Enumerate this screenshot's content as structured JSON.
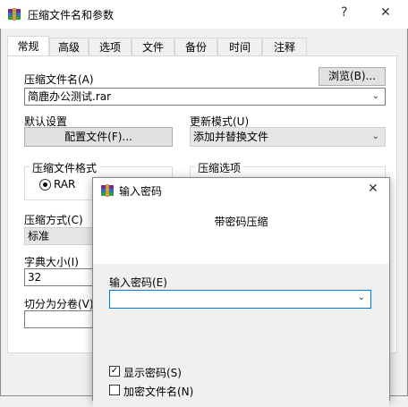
{
  "window": {
    "title": "压缩文件名和参数",
    "help": "?",
    "close": "✕"
  },
  "tabs": [
    {
      "label": "常规"
    },
    {
      "label": "高级"
    },
    {
      "label": "选项"
    },
    {
      "label": "文件"
    },
    {
      "label": "备份"
    },
    {
      "label": "时间"
    },
    {
      "label": "注释"
    }
  ],
  "general": {
    "archive_name_label": "压缩文件名(A)",
    "browse_button": "浏览(B)...",
    "archive_name_value": "简鹿办公测试.rar",
    "default_settings_label": "默认设置",
    "profiles_button": "配置文件(F)...",
    "update_mode_label": "更新模式(U)",
    "update_mode_value": "添加并替换文件",
    "format_group_title": "压缩文件格式",
    "format_rar": "RAR",
    "options_group_title": "压缩选项",
    "method_label": "压缩方式(C)",
    "method_value": "标准",
    "dict_label": "字典大小(I)",
    "dict_value": "32",
    "split_label": "切分为分卷(V)"
  },
  "password_dialog": {
    "title": "输入密码",
    "close": "✕",
    "heading": "带密码压缩",
    "enter_label": "输入密码(E)",
    "password_value": "",
    "show_password": "显示密码(S)",
    "show_password_checked": true,
    "encrypt_names": "加密文件名(N)",
    "encrypt_names_checked": false
  }
}
